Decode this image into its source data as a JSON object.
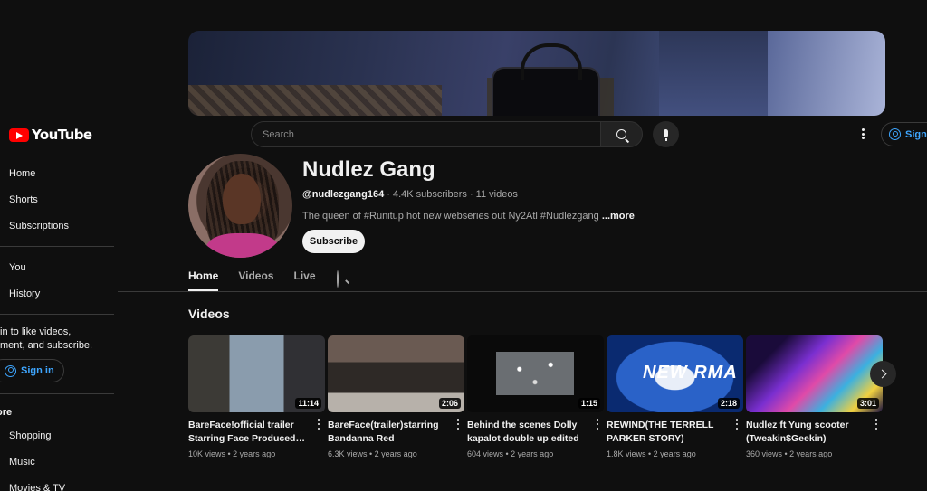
{
  "app": {
    "logo_text": "YouTube"
  },
  "sidebar": {
    "items_top": [
      {
        "label": "Home"
      },
      {
        "label": "Shorts"
      },
      {
        "label": "Subscriptions"
      }
    ],
    "items_you": [
      {
        "label": "You"
      },
      {
        "label": "History"
      }
    ],
    "signin_prompt_line1": "in to like videos,",
    "signin_prompt_line2": "ment, and subscribe.",
    "signin_label": "Sign in",
    "explore_heading": "ore",
    "items_explore": [
      {
        "label": "Shopping"
      },
      {
        "label": "Music"
      },
      {
        "label": "Movies & TV"
      }
    ]
  },
  "topbar": {
    "search_placeholder": "Search",
    "signin_label": "Sign"
  },
  "channel": {
    "name": "Nudlez Gang",
    "handle": "@nudlezgang164",
    "stats": " · 4.4K subscribers · 11 videos",
    "description": "The queen of #Runitup hot new webseries out Ny2Atl #Nudlezgang ",
    "more_label": "...more",
    "subscribe_label": "Subscribe"
  },
  "tabs": [
    {
      "label": "Home",
      "active": true
    },
    {
      "label": "Videos",
      "active": false
    },
    {
      "label": "Live",
      "active": false
    }
  ],
  "videos_section": {
    "title": "Videos",
    "items": [
      {
        "title": "BareFace!official trailer Starring Face Produced…",
        "duration": "11:14",
        "meta": "10K views • 2 years ago"
      },
      {
        "title": "BareFace(trailer)starring Bandanna Red",
        "duration": "2:06",
        "meta": "6.3K views • 2 years ago"
      },
      {
        "title": "Behind the scenes Dolly kapalot double up edited by…",
        "duration": "1:15",
        "meta": "604 views • 2 years ago"
      },
      {
        "title": "REWIND(THE TERRELL PARKER STORY)",
        "duration": "2:18",
        "meta": "1.8K views • 2 years ago"
      },
      {
        "title": "Nudlez ft Yung scooter (Tweakin$Geekin)",
        "duration": "3:01",
        "meta": "360 views • 2 years ago"
      }
    ]
  },
  "thumb4_text": "NEW RMA"
}
